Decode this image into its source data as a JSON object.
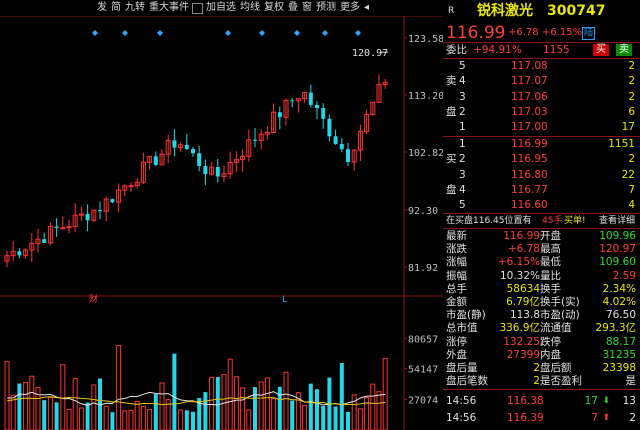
{
  "toolbar": {
    "items": [
      "发",
      "简",
      "九转",
      "重大事件",
      "加自选",
      "均线",
      "复权",
      "叠",
      "窗",
      "预测",
      "更多"
    ]
  },
  "chart": {
    "price_axis": [
      "123.58",
      "113.20",
      "102.82",
      "92.30",
      "81.92"
    ],
    "volume_axis": [
      "80657",
      "54147",
      "27074"
    ],
    "high_annotation": "120.97",
    "markers": [
      "财",
      "L"
    ]
  },
  "header": {
    "r_label": "R",
    "name": "锐科激光",
    "code": "300747",
    "price": "116.99",
    "change": "+6.78",
    "pct": "+6.15%",
    "badge": "陆"
  },
  "weibi": {
    "label": "委比",
    "ratio": "+94.91%",
    "diff": "1155",
    "buy_btn": "买",
    "sell_btn": "卖"
  },
  "sell_book": [
    {
      "level": "5",
      "price": "117.08",
      "vol": "2"
    },
    {
      "level": "4",
      "price": "117.07",
      "vol": "2"
    },
    {
      "level": "3",
      "price": "117.06",
      "vol": "2"
    },
    {
      "level": "2",
      "price": "117.03",
      "vol": "6"
    },
    {
      "level": "1",
      "price": "117.00",
      "vol": "17"
    }
  ],
  "sell_side_chars": [
    "卖",
    "盘"
  ],
  "buy_book": [
    {
      "level": "1",
      "price": "116.99",
      "vol": "1151"
    },
    {
      "level": "2",
      "price": "116.95",
      "vol": "2"
    },
    {
      "level": "3",
      "price": "116.80",
      "vol": "22"
    },
    {
      "level": "4",
      "price": "116.77",
      "vol": "7"
    },
    {
      "level": "5",
      "price": "116.60",
      "vol": "4"
    }
  ],
  "buy_side_chars": [
    "买",
    "盘"
  ],
  "info_line": {
    "text_a": "在买盘116.45位置有",
    "text_b": "45手",
    "text_c": "买单!",
    "link": "查看详细"
  },
  "stats": [
    {
      "l1": "最新",
      "v1": "116.99",
      "c1": "red",
      "l2": "开盘",
      "v2": "109.96",
      "c2": "green"
    },
    {
      "l1": "涨跌",
      "v1": "+6.78",
      "c1": "red",
      "l2": "最高",
      "v2": "120.97",
      "c2": "red"
    },
    {
      "l1": "涨幅",
      "v1": "+6.15%",
      "c1": "red",
      "l2": "最低",
      "v2": "109.60",
      "c2": "green"
    },
    {
      "l1": "振幅",
      "v1": "10.32%",
      "c1": "white",
      "l2": "量比",
      "v2": "2.59",
      "c2": "red"
    },
    {
      "l1": "总手",
      "v1": "58634",
      "c1": "yellow",
      "l2": "换手",
      "v2": "2.34%",
      "c2": "yellow"
    },
    {
      "l1": "金额",
      "v1": "6.79亿",
      "c1": "yellow",
      "l2": "换手(实)",
      "v2": "4.02%",
      "c2": "yellow"
    },
    {
      "l1": "市盈(静)",
      "v1": "113.8",
      "c1": "white",
      "l2": "市盈(动)",
      "v2": "76.50",
      "c2": "white"
    },
    {
      "l1": "总市值",
      "v1": "336.9亿",
      "c1": "yellow",
      "l2": "流通值",
      "v2": "293.3亿",
      "c2": "yellow"
    },
    {
      "l1": "涨停",
      "v1": "132.25",
      "c1": "red",
      "l2": "跌停",
      "v2": "88.17",
      "c2": "green"
    },
    {
      "l1": "外盘",
      "v1": "27399",
      "c1": "red",
      "l2": "内盘",
      "v2": "31235",
      "c2": "green"
    },
    {
      "l1": "盘后量",
      "v1": "2",
      "c1": "yellow",
      "l2": "盘后额",
      "v2": "23398",
      "c2": "yellow"
    },
    {
      "l1": "盘后笔数",
      "v1": "2",
      "c1": "yellow",
      "l2": "是否盈利",
      "v2": "是",
      "c2": "white"
    }
  ],
  "ticks": [
    {
      "time": "14:56",
      "price": "116.38",
      "vol": "17",
      "dir": "down",
      "count": "13"
    },
    {
      "time": "14:56",
      "price": "116.39",
      "vol": "7",
      "dir": "up",
      "count": "2"
    }
  ],
  "colors": {
    "up": "#ff3232",
    "down": "#22d8e8",
    "ma5": "#e8e8e8",
    "ma10": "#e8c800",
    "grid": "#8a1414"
  }
}
